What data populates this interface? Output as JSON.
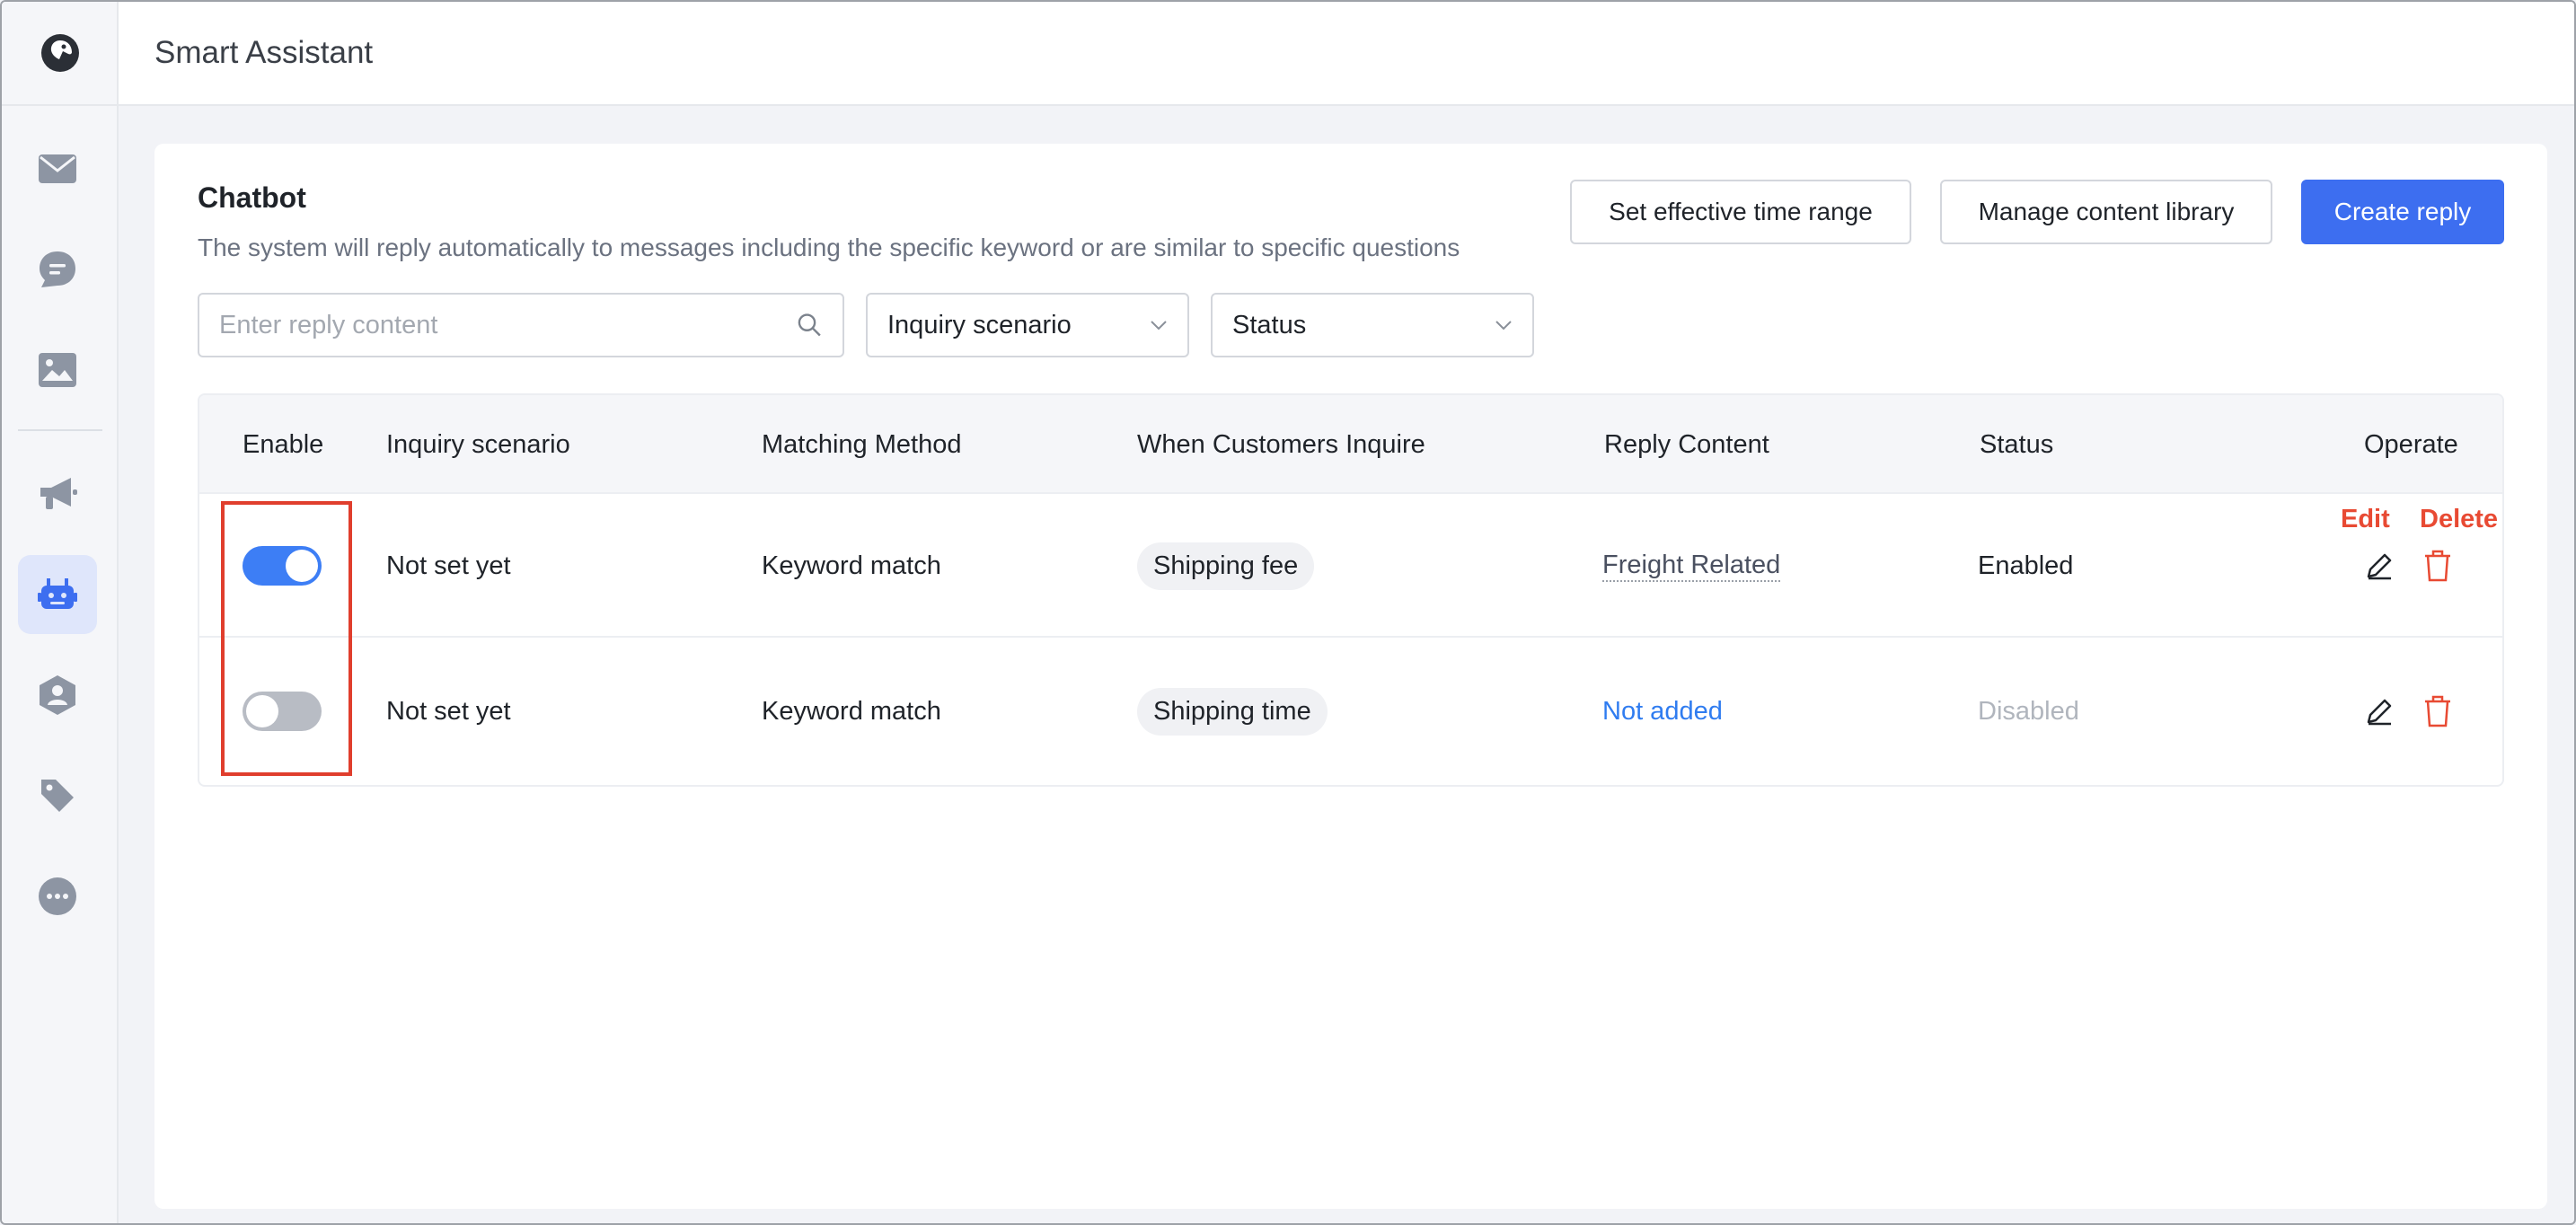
{
  "app": {
    "title": "Smart Assistant"
  },
  "sidebar": {
    "icons": [
      "logo-icon",
      "mail-icon",
      "chat-icon",
      "image-icon",
      "megaphone-icon",
      "robot-icon",
      "contact-icon",
      "tag-icon",
      "more-icon"
    ],
    "active": "robot-icon"
  },
  "card": {
    "title": "Chatbot",
    "description": "The system will reply automatically to messages including the specific keyword or are similar to specific questions"
  },
  "toolbar": {
    "time_range_label": "Set effective time range",
    "content_library_label": "Manage content library",
    "create_reply_label": "Create reply"
  },
  "filters": {
    "search_placeholder": "Enter reply content",
    "scenario_label": "Inquiry scenario",
    "status_label": "Status"
  },
  "table": {
    "columns": {
      "enable": "Enable",
      "scenario": "Inquiry scenario",
      "method": "Matching Method",
      "inquire": "When Customers Inquire",
      "reply": "Reply Content",
      "status": "Status",
      "operate": "Operate"
    },
    "rows": [
      {
        "enabled": true,
        "scenario": "Not set yet",
        "method": "Keyword match",
        "inquire": "Shipping fee",
        "reply": "Freight Related",
        "status": "Enabled"
      },
      {
        "enabled": false,
        "scenario": "Not set yet",
        "method": "Keyword match",
        "inquire": "Shipping time",
        "reply": "Not added",
        "status": "Disabled"
      }
    ]
  },
  "annotations": {
    "edit": "Edit",
    "delete": "Delete"
  },
  "colors": {
    "primary": "#3d6ef0",
    "toggle_on": "#3d7ef5",
    "danger": "#e84a33",
    "link": "#2f7cf0"
  }
}
